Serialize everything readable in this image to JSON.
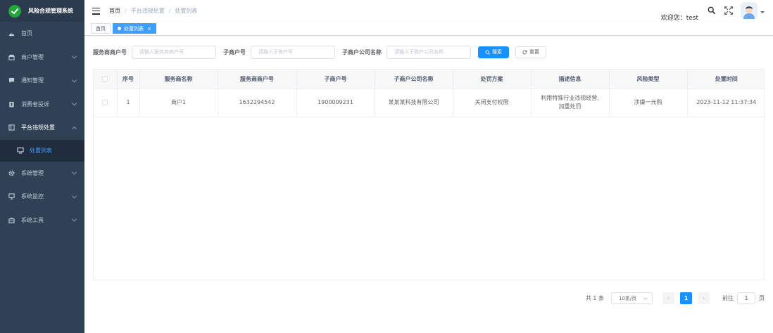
{
  "app": {
    "title": "风险合规管理系统",
    "brand_color": "#22a63a"
  },
  "sidebar": {
    "items": [
      {
        "label": "首页",
        "icon": "dashboard-icon"
      },
      {
        "label": "商户管理",
        "icon": "store-icon"
      },
      {
        "label": "通知管理",
        "icon": "message-icon"
      },
      {
        "label": "消费者投诉",
        "icon": "clipboard-icon"
      },
      {
        "label": "平台违规处置",
        "icon": "columns-icon"
      },
      {
        "label": "处置列表",
        "icon": "monitor-icon"
      },
      {
        "label": "系统管理",
        "icon": "gear-icon"
      },
      {
        "label": "系统监控",
        "icon": "monitor-icon"
      },
      {
        "label": "系统工具",
        "icon": "toolbox-icon"
      }
    ]
  },
  "navbar": {
    "breadcrumb": [
      "首页",
      "平台违规处置",
      "处置列表"
    ],
    "welcome": "欢迎您：test"
  },
  "tags": {
    "home": "首页",
    "active": "处置列表",
    "close": "×"
  },
  "search": {
    "fields": [
      {
        "label": "服务商商户号",
        "placeholder": "请输入服务商商户号"
      },
      {
        "label": "子商户号",
        "placeholder": "请输入子商户号"
      },
      {
        "label": "子商户公司名称",
        "placeholder": "请输入子商户公司名称"
      }
    ],
    "search_label": "搜索",
    "reset_label": "重置"
  },
  "table": {
    "columns": [
      "序号",
      "服务商名称",
      "服务商商户号",
      "子商户号",
      "子商户公司名称",
      "处罚方案",
      "描述信息",
      "风险类型",
      "处置时间"
    ],
    "rows": [
      {
        "index": "1",
        "provider_name": "商户1",
        "provider_no": "1632294542",
        "sub_no": "1900009231",
        "sub_company": "某某某科技有限公司",
        "penalty": "关闭支付权限",
        "desc_line1": "利用特殊行业违规经营,",
        "desc_line2": "加重处罚",
        "risk_type": "涉嫌一元购",
        "time": "2023-11-12 11:37:34"
      }
    ]
  },
  "pagination": {
    "total": "共 1 条",
    "page_size": "10条/页",
    "current": "1",
    "goto_label": "前往",
    "goto_value": "1",
    "page_suffix": "页"
  }
}
